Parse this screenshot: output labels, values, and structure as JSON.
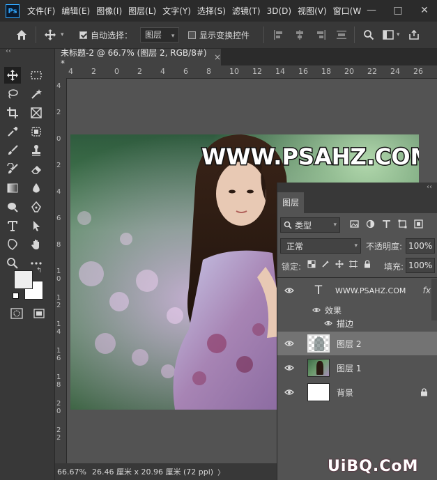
{
  "app": {
    "logo": "Ps",
    "menus": [
      "文件(F)",
      "编辑(E)",
      "图像(I)",
      "图层(L)",
      "文字(Y)",
      "选择(S)",
      "滤镜(T)",
      "3D(D)",
      "视图(V)",
      "窗口(W"
    ],
    "window_controls": {
      "minimize": "—",
      "maximize": "□",
      "close": "✕"
    }
  },
  "options_bar": {
    "auto_select_label": "自动选择：",
    "auto_select_checked": true,
    "auto_select_target": "图层",
    "show_transform_label": "显示变换控件",
    "show_transform_checked": false
  },
  "document": {
    "tab_title": "未标题-2 @ 66.7% (图层 2, RGB/8#) *",
    "close_glyph": "×",
    "h_ruler_ticks": [
      "4",
      "2",
      "0",
      "2",
      "4",
      "6",
      "8",
      "10",
      "12",
      "14",
      "16",
      "18",
      "20",
      "22",
      "24",
      "26"
    ],
    "v_ruler_ticks": [
      "4",
      "2",
      "0",
      "2",
      "4",
      "6",
      "8",
      "10",
      "12",
      "14",
      "16",
      "18",
      "20",
      "22"
    ],
    "canvas_text": "WWW.PSAHZ.COM"
  },
  "status_bar": {
    "zoom": "66.67%",
    "doc_info": "26.46 厘米 x 20.96 厘米 (72 ppi)",
    "arrow": "〉"
  },
  "layers_panel": {
    "collapse_glyph": "‹‹",
    "tab_label": "图层",
    "filter_label": "类型",
    "blend_mode": "正常",
    "opacity_label": "不透明度:",
    "opacity_value": "100%",
    "lock_label": "锁定:",
    "fill_label": "填充:",
    "fill_value": "100%",
    "layers": [
      {
        "name": "WWW.PSAHZ.COM",
        "type": "text",
        "fx": "fx"
      },
      {
        "name": "效果",
        "type": "effects-group"
      },
      {
        "name": "描边",
        "type": "effect"
      },
      {
        "name": "图层 2",
        "type": "pixel",
        "selected": true
      },
      {
        "name": "图层 1",
        "type": "pixel"
      },
      {
        "name": "背景",
        "type": "background",
        "locked": true
      }
    ]
  },
  "watermark": "UiBQ.CoM",
  "colors": {
    "accent": "#31a8ff",
    "panel": "#535353",
    "dark": "#383838",
    "selected_row": "#737373"
  }
}
